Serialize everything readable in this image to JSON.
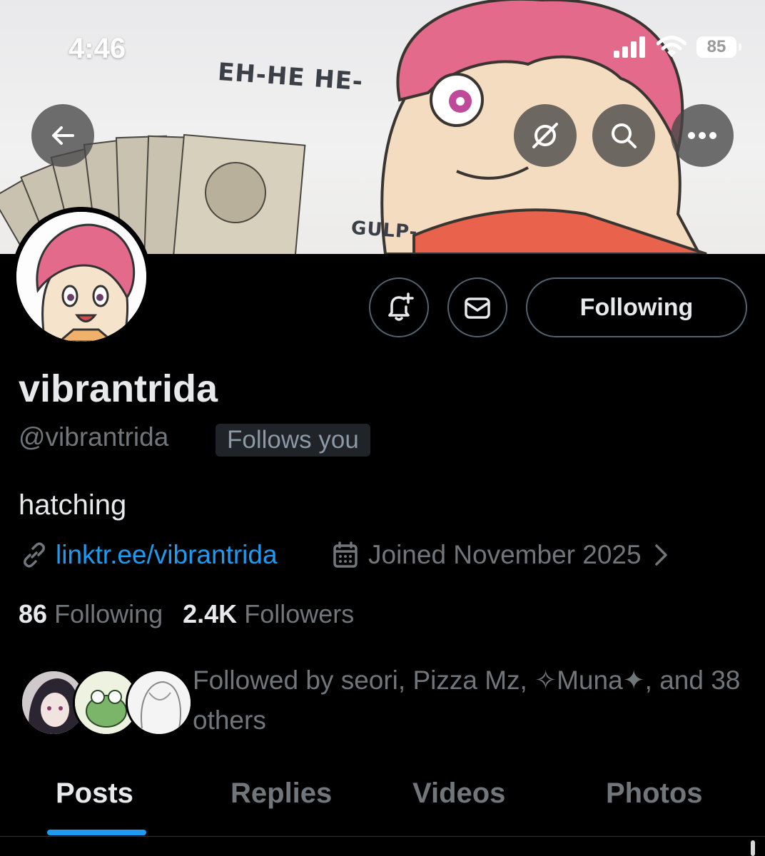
{
  "status_bar": {
    "time": "4:46",
    "battery": "85"
  },
  "banner": {
    "sfx_top": "EH-HE HE-",
    "sfx_bottom": "GULP-"
  },
  "header_actions": {
    "back_icon": "arrow-left-icon",
    "grok_icon": "grok-icon",
    "search_icon": "search-icon",
    "more_icon": "more-horizontal-icon"
  },
  "profile": {
    "display_name": "vibrantrida",
    "handle": "@vibrantrida",
    "follows_you_badge": "Follows you",
    "bio": "hatching",
    "link": "linktr.ee/vibrantrida",
    "joined": "Joined November 2025"
  },
  "actions": {
    "following_label": "Following",
    "notify_icon": "bell-plus-icon",
    "message_icon": "envelope-icon"
  },
  "counts": {
    "following_count": "86",
    "following_label": "Following",
    "followers_count": "2.4K",
    "followers_label": "Followers"
  },
  "followed_by": "Followed by seori, Pizza Mz, ✧Muna✦, and 38 others",
  "tabs": [
    {
      "label": "Posts",
      "active": true
    },
    {
      "label": "Replies",
      "active": false
    },
    {
      "label": "Videos",
      "active": false
    },
    {
      "label": "Photos",
      "active": false
    }
  ],
  "colors": {
    "accent": "#1d9bf0",
    "background": "#000000",
    "muted": "#71767b"
  }
}
